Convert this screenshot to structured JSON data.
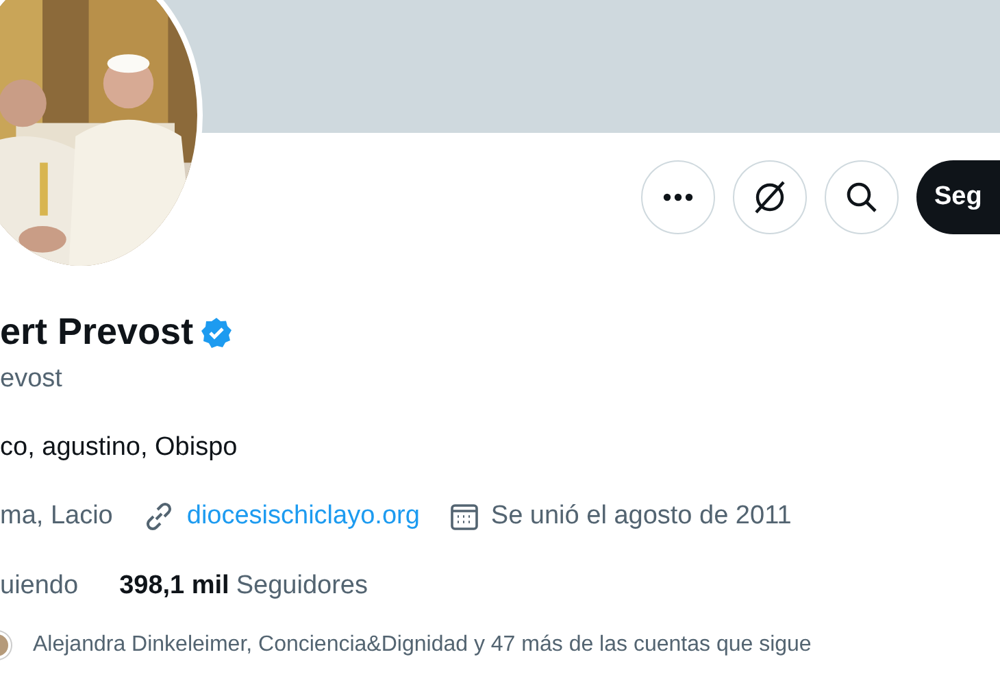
{
  "actions": [
    {
      "kind": "more"
    },
    {
      "kind": "grok"
    },
    {
      "kind": "search"
    },
    {
      "kind": "follow",
      "label": "Seg"
    }
  ],
  "profile": {
    "name": "ert Prevost",
    "verified": true,
    "handle": "evost",
    "bio": "co, agustino, Obispo",
    "location": "ma, Lacio",
    "website": "diocesischiclayo.org",
    "joined": "Se unió el agosto de 2011",
    "following_label": "uiendo",
    "followers_count": "398,1 mil",
    "followers_label": "Seguidores",
    "followed_by": "Alejandra Dinkeleimer, Conciencia&Dignidad y 47 más de las cuentas que sigue"
  }
}
